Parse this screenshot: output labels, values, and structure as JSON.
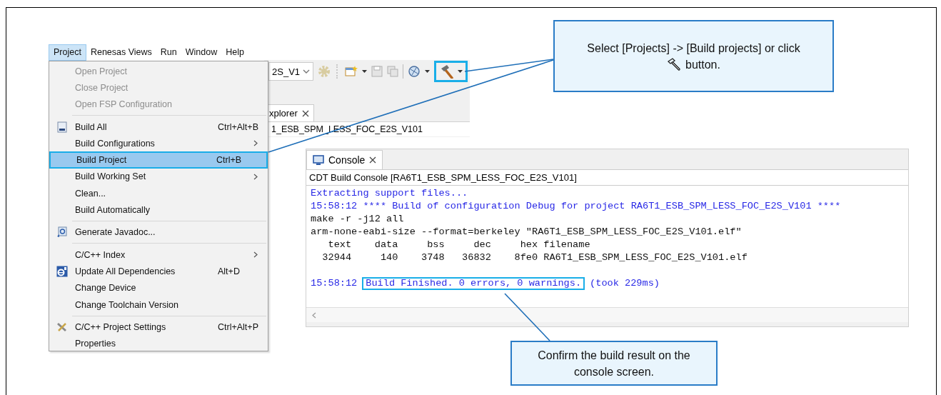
{
  "menubar": [
    {
      "label": "Project",
      "selected": true
    },
    {
      "label": "Renesas Views",
      "selected": false
    },
    {
      "label": "Run",
      "selected": false
    },
    {
      "label": "Window",
      "selected": false
    },
    {
      "label": "Help",
      "selected": false
    }
  ],
  "menu": {
    "items": [
      {
        "kind": "item",
        "label": "Open Project",
        "disabled": true,
        "submenu": false,
        "selected": false
      },
      {
        "kind": "item",
        "label": "Close Project",
        "disabled": true,
        "submenu": false,
        "selected": false
      },
      {
        "kind": "item",
        "label": "Open FSP Configuration",
        "disabled": true,
        "submenu": false,
        "selected": false
      },
      {
        "kind": "separator"
      },
      {
        "kind": "item",
        "label": "Build All",
        "shortcut": "Ctrl+Alt+B",
        "disabled": false,
        "submenu": false,
        "selected": false
      },
      {
        "kind": "item",
        "label": "Build Configurations",
        "disabled": false,
        "submenu": true,
        "selected": false
      },
      {
        "kind": "item",
        "label": "Build Project",
        "shortcut": "Ctrl+B",
        "disabled": false,
        "submenu": false,
        "selected": true
      },
      {
        "kind": "item",
        "label": "Build Working Set",
        "disabled": false,
        "submenu": true,
        "selected": false
      },
      {
        "kind": "item",
        "label": "Clean...",
        "disabled": false,
        "submenu": false,
        "selected": false
      },
      {
        "kind": "item",
        "label": "Build Automatically",
        "disabled": false,
        "submenu": false,
        "selected": false
      },
      {
        "kind": "separator"
      },
      {
        "kind": "item",
        "label": "Generate Javadoc...",
        "disabled": false,
        "submenu": false,
        "selected": false
      },
      {
        "kind": "separator"
      },
      {
        "kind": "item",
        "label": "C/C++ Index",
        "disabled": false,
        "submenu": true,
        "selected": false
      },
      {
        "kind": "item",
        "label": "Update All Dependencies",
        "shortcut": "Alt+D",
        "disabled": false,
        "submenu": false,
        "selected": false
      },
      {
        "kind": "item",
        "label": "Change Device",
        "disabled": false,
        "submenu": false,
        "selected": false
      },
      {
        "kind": "item",
        "label": "Change Toolchain Version",
        "disabled": false,
        "submenu": false,
        "selected": false
      },
      {
        "kind": "separator"
      },
      {
        "kind": "item",
        "label": "C/C++ Project Settings",
        "shortcut": "Ctrl+Alt+P",
        "disabled": false,
        "submenu": false,
        "selected": false
      },
      {
        "kind": "item",
        "label": "Properties",
        "disabled": false,
        "submenu": false,
        "selected": false
      }
    ]
  },
  "toolbar": {
    "combo_value": "2S_V1",
    "hammer_highlighted": true
  },
  "explorer": {
    "tab": "xplorer",
    "tree_item": "1_ESB_SPM_LESS_FOC_E2S_V101"
  },
  "console": {
    "tab": "Console",
    "title": "CDT Build Console [RA6T1_ESB_SPM_LESS_FOC_E2S_V101]",
    "lines": [
      {
        "kind": "text",
        "segments": [
          {
            "text": "Extracting support files...",
            "kind": "info",
            "highlighted": false
          }
        ]
      },
      {
        "kind": "text",
        "segments": [
          {
            "text": "15:58:12 **** Build of configuration Debug for project RA6T1_ESB_SPM_LESS_FOC_E2S_V101 ****",
            "kind": "info",
            "highlighted": false
          }
        ]
      },
      {
        "kind": "text",
        "segments": [
          {
            "text": "make -r -j12 all",
            "kind": "output",
            "highlighted": false
          }
        ]
      },
      {
        "kind": "text",
        "segments": [
          {
            "text": "arm-none-eabi-size --format=berkeley \"RA6T1_ESB_SPM_LESS_FOC_E2S_V101.elf\"",
            "kind": "output",
            "highlighted": false
          }
        ]
      },
      {
        "kind": "text",
        "segments": [
          {
            "text": "   text    data     bss     dec     hex filename",
            "kind": "output",
            "highlighted": false
          }
        ]
      },
      {
        "kind": "text",
        "segments": [
          {
            "text": "  32944     140    3748   36832    8fe0 RA6T1_ESB_SPM_LESS_FOC_E2S_V101.elf",
            "kind": "output",
            "highlighted": false
          }
        ]
      },
      {
        "kind": "blank"
      },
      {
        "kind": "text",
        "segments": [
          {
            "text": "15:58:12",
            "kind": "info",
            "highlighted": false
          },
          {
            "text": "Build Finished. 0 errors, 0 warnings.",
            "kind": "info",
            "highlighted": true
          },
          {
            "text": "(took 229ms)",
            "kind": "info",
            "highlighted": false
          }
        ]
      }
    ]
  },
  "callouts": [
    {
      "text_before_icon": "Select [Projects] -> [Build projects] or click",
      "text_after_icon": "button."
    },
    {
      "text_before_icon": "Confirm the build result on the console screen."
    }
  ]
}
